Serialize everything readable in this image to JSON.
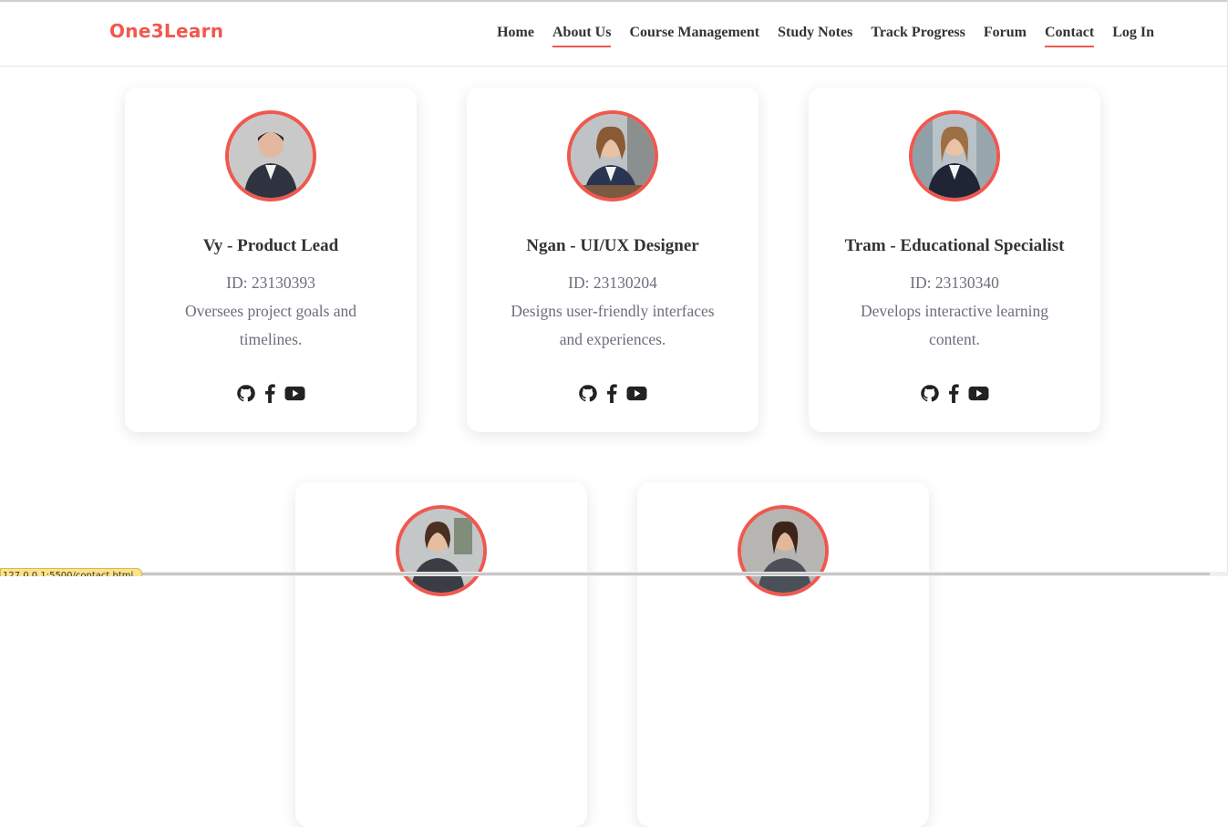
{
  "header": {
    "logo": "One3Learn",
    "nav": [
      {
        "label": "Home",
        "active": false
      },
      {
        "label": "About Us",
        "active": true
      },
      {
        "label": "Course Management",
        "active": false
      },
      {
        "label": "Study Notes",
        "active": false
      },
      {
        "label": "Track Progress",
        "active": false
      },
      {
        "label": "Forum",
        "active": false
      },
      {
        "label": "Contact",
        "active": true
      },
      {
        "label": "Log In",
        "active": false
      }
    ]
  },
  "team": [
    {
      "title": "Vy - Product Lead",
      "id": "ID: 23130393",
      "description": "Oversees project goals and timelines."
    },
    {
      "title": "Ngan - UI/UX Designer",
      "id": "ID: 23130204",
      "description": "Designs user-friendly interfaces and experiences."
    },
    {
      "title": "Tram - Educational Specialist",
      "id": "ID: 23130340",
      "description": "Develops interactive learning content."
    },
    {
      "title": "",
      "id": "",
      "description": ""
    },
    {
      "title": "",
      "id": "",
      "description": ""
    }
  ],
  "icons": {
    "github": "github-icon",
    "facebook": "facebook-icon",
    "youtube": "youtube-icon"
  },
  "colors": {
    "accent": "#f0584f",
    "text": "#333333",
    "muted": "#6b6f7a"
  },
  "status_url": "127.0.0.1:5500/contact.html"
}
